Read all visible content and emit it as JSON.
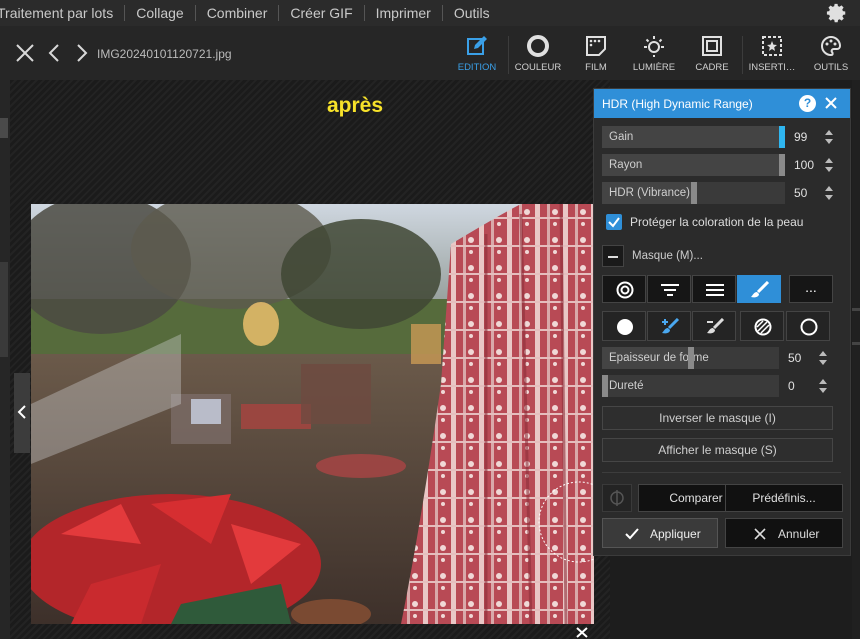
{
  "menu": {
    "items": [
      "Traitement par lots",
      "Collage",
      "Combiner",
      "Créer GIF",
      "Imprimer",
      "Outils"
    ]
  },
  "toolbar": {
    "filename": "IMG20240101120721.jpg",
    "tools": [
      {
        "label": "EDITION",
        "icon": "edit-icon",
        "active": true
      },
      {
        "label": "COULEUR",
        "icon": "color-circle-icon"
      },
      {
        "label": "FILM",
        "icon": "film-icon"
      },
      {
        "label": "LUMIÈRE",
        "icon": "sun-icon"
      },
      {
        "label": "CADRE",
        "icon": "frame-icon"
      },
      {
        "label": "INSERTI…",
        "icon": "insert-star-icon"
      },
      {
        "label": "OUTILS",
        "icon": "palette-icon"
      }
    ]
  },
  "canvas": {
    "view_label": "après"
  },
  "panel": {
    "title": "HDR (High Dynamic Range)",
    "help": "?",
    "sliders": [
      {
        "label": "Gain",
        "value": "99",
        "level": 0.99,
        "accent": true
      },
      {
        "label": "Rayon",
        "value": "100",
        "level": 1.0
      },
      {
        "label": "HDR (Vibrance)",
        "value": "50",
        "level": 0.5
      }
    ],
    "skin_checkbox": {
      "label": "Protéger la coloration de la peau",
      "checked": true
    },
    "mask_label": "Masque (M)...",
    "mask_tabs": [
      "radial-mask-icon",
      "gradient-mask-icon",
      "lines-mask-icon",
      "brush-mask-icon"
    ],
    "mask_more": "...",
    "brush_tools": [
      "circle-fill-icon",
      "brush-add-icon",
      "brush-erase-icon",
      "hatch-circle-icon",
      "circle-outline-icon"
    ],
    "brush_sliders": [
      {
        "label": "Epaisseur de forme",
        "value": "50",
        "level": 0.5
      },
      {
        "label": "Dureté",
        "value": "0",
        "level": 0.0
      }
    ],
    "invert_mask": "Inverser le masque (I)",
    "show_mask": "Afficher le masque (S)",
    "compare": "Comparer",
    "presets": "Prédéfinis...",
    "apply": "Appliquer",
    "cancel": "Annuler"
  },
  "colors": {
    "accent": "#2f8fd8",
    "slider_accent": "#2fb6f0",
    "view_label": "#f7e22a"
  }
}
